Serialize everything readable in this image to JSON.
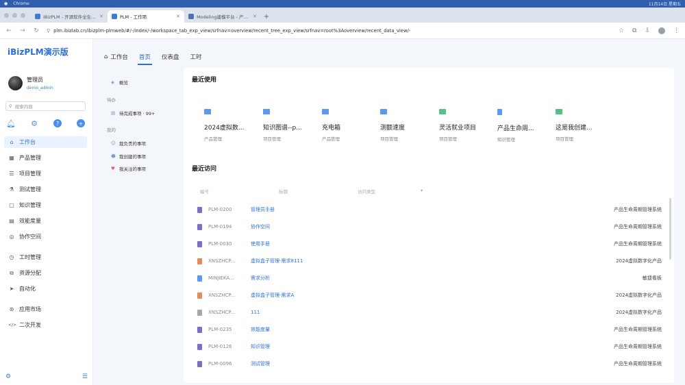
{
  "os_bar": {
    "app": "Chrome",
    "clock": "11月14日 星期五"
  },
  "browser": {
    "tabs": [
      {
        "label": "iBizPLM - 开源软件全生命周期",
        "active": false
      },
      {
        "label": "PLM - 工作项",
        "active": true
      },
      {
        "label": "Modeling建模平台 - 产品主页",
        "active": false
      }
    ],
    "new_tab": "+",
    "url": "plm.ibizlab.cn/ibizplm-plmweb/#/-/index/-/workspace_tab_exp_view/srfnav=overview/recent_tree_exp_view/srfnav=root%3Aoverview/recent_data_view/-"
  },
  "sidebar": {
    "brand": "iBizPLM演示版",
    "user_name": "管理员",
    "user_id": "demo_admin",
    "search_placeholder": "搜索内容",
    "menu": [
      {
        "label": "工作台",
        "icon": "⌂",
        "name": "home-icon"
      },
      {
        "label": "产品管理",
        "icon": "▦",
        "name": "grid-icon"
      },
      {
        "label": "项目管理",
        "icon": "☰",
        "name": "list-icon"
      },
      {
        "label": "测试管理",
        "icon": "⚗",
        "name": "flask-icon"
      },
      {
        "label": "知识管理",
        "icon": "▢",
        "name": "book-icon"
      },
      {
        "label": "效能度量",
        "icon": "▤",
        "name": "chart-icon"
      },
      {
        "label": "协作空间",
        "icon": "◎",
        "name": "chat-icon"
      },
      {
        "label": "工时管理",
        "icon": "◷",
        "name": "clock-icon"
      },
      {
        "label": "资源分配",
        "icon": "⧉",
        "name": "resource-icon"
      },
      {
        "label": "自动化",
        "icon": "➤",
        "name": "send-icon"
      },
      {
        "label": "应用市场",
        "icon": "⊛",
        "name": "market-icon"
      },
      {
        "label": "二次开发",
        "icon": "</>",
        "name": "code-icon"
      }
    ]
  },
  "top_tabs": [
    {
      "label": "工作台",
      "active": false
    },
    {
      "label": "首页",
      "active": true
    },
    {
      "label": "仪表盘",
      "active": false
    },
    {
      "label": "工时",
      "active": false
    }
  ],
  "col_nav": {
    "overview": "概览",
    "group_todo": "待办",
    "todo_item": "待完成事项 · 99+",
    "group_mine": "我的",
    "mine_items": [
      "我负责的事项",
      "我创建的事项",
      "我关注的事项"
    ]
  },
  "recent_used": {
    "title": "最近使用",
    "cards": [
      {
        "title": "2024虚拟数...",
        "sub": "产品管理",
        "icon": "folder"
      },
      {
        "title": "知识图谱--p...",
        "sub": "项目管理",
        "icon": "folder"
      },
      {
        "title": "充电箱",
        "sub": "产品管理",
        "icon": "folder"
      },
      {
        "title": "测额速度",
        "sub": "项目管理",
        "icon": "folder"
      },
      {
        "title": "灵活就业项目",
        "sub": "项目管理",
        "icon": "folder-green"
      },
      {
        "title": "产品生命周...",
        "sub": "知识管理",
        "icon": "file"
      },
      {
        "title": "这是我创建...",
        "sub": "项目管理",
        "icon": "folder-green"
      }
    ]
  },
  "recent_visit": {
    "title": "最近访问",
    "headers": [
      "编号",
      "标题",
      "访问类型"
    ],
    "rows": [
      {
        "code": "PLM-0200",
        "name": "管理员手册",
        "project": "产品生命周期管理系统",
        "icon": "purple"
      },
      {
        "code": "PLM-0194",
        "name": "协作空间",
        "project": "产品生命周期管理系统",
        "icon": "purple"
      },
      {
        "code": "PLM-0030",
        "name": "使用手册",
        "project": "产品生命周期管理系统",
        "icon": "purple"
      },
      {
        "code": "XNSZHCP...",
        "name": "虚拟盒子管理-需求8111",
        "project": "2024虚拟数字化产品",
        "icon": "orange"
      },
      {
        "code": "MINJIEKA...",
        "name": "需求分析",
        "project": "敏捷看板",
        "icon": "blue"
      },
      {
        "code": "XNSZHCP...",
        "name": "虚拟盒子管理-需求A",
        "project": "2024虚拟数字化产品",
        "icon": "orange"
      },
      {
        "code": "XNSZHCP...",
        "name": "111",
        "project": "2024虚拟数字化产品",
        "icon": "gray"
      },
      {
        "code": "PLM-0235",
        "name": "效能度量",
        "project": "产品生命周期管理系统",
        "icon": "purple"
      },
      {
        "code": "PLM-0126",
        "name": "知识管理",
        "project": "产品生命周期管理系统",
        "icon": "purple"
      },
      {
        "code": "PLM-0096",
        "name": "测试管理",
        "project": "产品生命周期管理系统",
        "icon": "purple"
      }
    ]
  }
}
